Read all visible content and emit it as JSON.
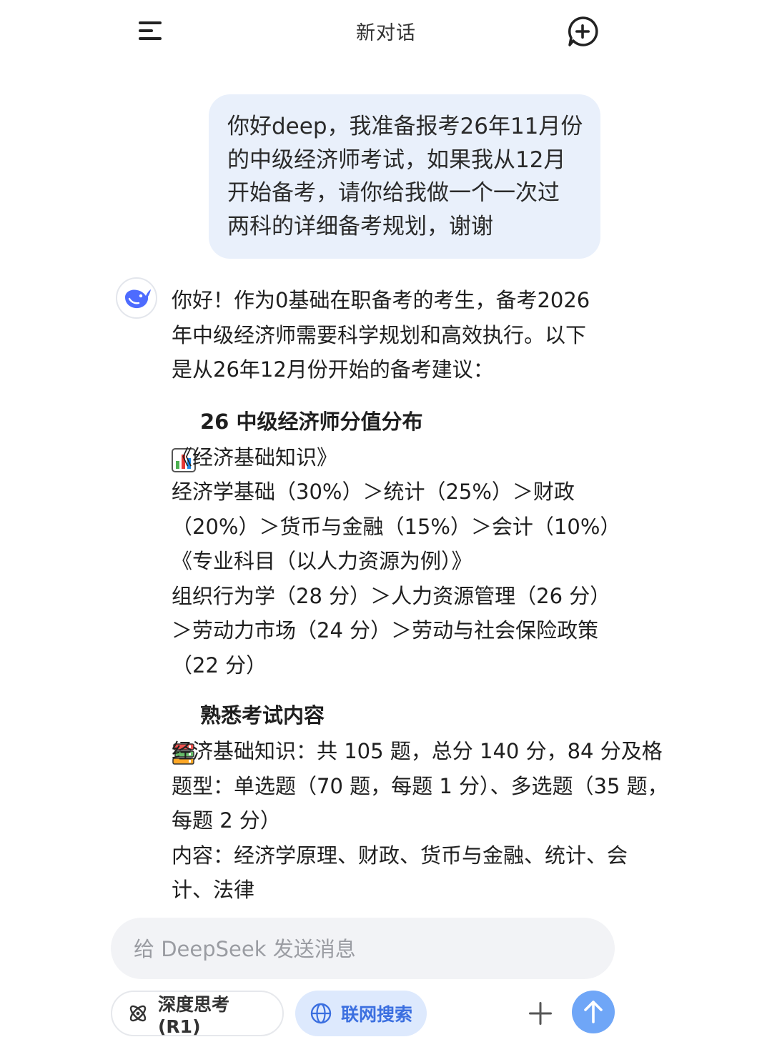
{
  "header": {
    "title": "新对话",
    "menu_icon": "menu-icon",
    "new_chat_icon": "new-chat-icon"
  },
  "user_message": {
    "text": "你好deep，我准备报考26年11月份\n的中级经济师考试，如果我从12月\n开始备考，请你给我做一个一次过\n两科的详细备考规划，谢谢"
  },
  "assistant": {
    "avatar_icon": "deepseek-whale-icon",
    "intro": "你好！作为0基础在职备考的考生，备考2026\n年中级经济师需要科学规划和高效执行。以下\n是从26年12月份开始的备考建议：",
    "section1": {
      "emoji": "bar-chart-emoji",
      "heading": "26 中级经济师分值分布",
      "book1_title": "《经济基础知识》",
      "book1_detail": "经济学基础（30%）＞统计（25%）＞财政\n（20%）＞货币与金融（15%）＞会计（10%）",
      "book2_title": "《专业科目（以人力资源为例）》",
      "book2_detail": "组织行为学（28 分）＞人力资源管理（26 分）\n＞劳动力市场（24 分）＞劳动与社会保险政策\n（22 分）"
    },
    "section2": {
      "emoji": "books-emoji",
      "heading": "熟悉考试内容",
      "line1": "经济基础知识：共 105 题，总分 140 分，84 分及格",
      "line2": "题型：单选题（70 题，每题 1 分）、多选题（35 题，\n每题 2 分）",
      "line3": "内容：经济学原理、财政、货币与金融、统计、会\n计、法律"
    }
  },
  "composer": {
    "placeholder": "给 DeepSeek 发送消息",
    "deep_think_label": "深度思考 (R1)",
    "web_search_label": "联网搜索"
  },
  "colors": {
    "user_bubble": "#e9f0fb",
    "accent": "#3b6fe0",
    "send_button": "#6fa6f7"
  }
}
